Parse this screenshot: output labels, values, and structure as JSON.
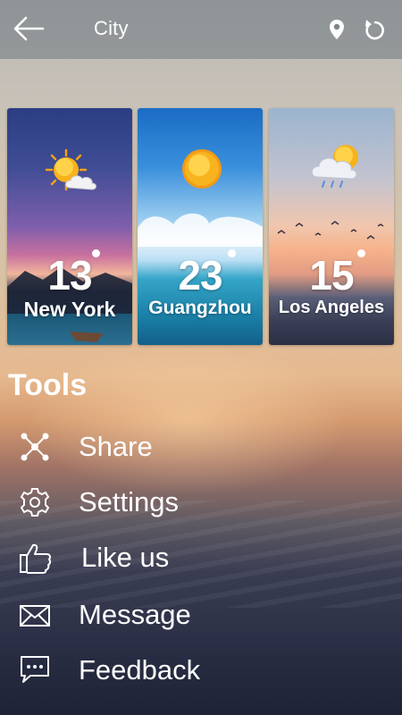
{
  "header": {
    "title": "City",
    "back_icon": "back-arrow-icon",
    "location_icon": "location-pin-icon",
    "refresh_icon": "refresh-icon"
  },
  "cities": [
    {
      "name": "New York",
      "temp": "13",
      "weather_icon": "sun-cloud-icon"
    },
    {
      "name": "Guangzhou",
      "temp": "23",
      "weather_icon": "sun-icon"
    },
    {
      "name": "Los Angeles",
      "temp": "15",
      "weather_icon": "cloud-rain-sun-icon"
    }
  ],
  "tools": {
    "title": "Tools",
    "items": [
      {
        "label": "Share",
        "icon": "share-icon"
      },
      {
        "label": "Settings",
        "icon": "gear-icon"
      },
      {
        "label": "Like us",
        "icon": "thumbs-up-icon"
      },
      {
        "label": "Message",
        "icon": "envelope-icon"
      },
      {
        "label": "Feedback",
        "icon": "chat-bubble-icon"
      }
    ]
  }
}
